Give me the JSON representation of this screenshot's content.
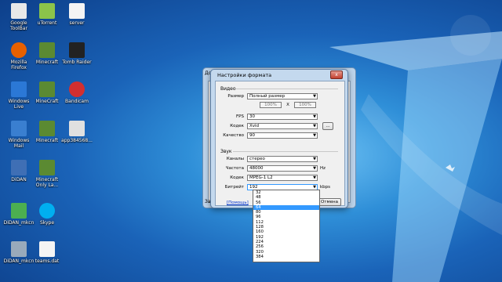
{
  "desktop": {
    "icons": [
      {
        "label": "Google ToolBar",
        "icon": "google-toolbar-icon"
      },
      {
        "label": "uTorrent",
        "icon": "utorrent-icon"
      },
      {
        "label": "server",
        "icon": "file-icon"
      },
      {
        "label": "Mozilla Firefox",
        "icon": "firefox-icon"
      },
      {
        "label": "Minecraft",
        "icon": "minecraft-icon"
      },
      {
        "label": "Tomb Raider",
        "icon": "tomb-raider-icon"
      },
      {
        "label": "Windows Live",
        "icon": "windows-live-icon"
      },
      {
        "label": "MineCraft",
        "icon": "minecraft-icon"
      },
      {
        "label": "Bandicam",
        "icon": "bandicam-icon"
      },
      {
        "label": "Windows Mail",
        "icon": "windows-mail-icon"
      },
      {
        "label": "Minecraft",
        "icon": "minecraft-icon"
      },
      {
        "label": "app384568...",
        "icon": "app-icon"
      },
      {
        "label": "DiDAN",
        "icon": "computer-icon"
      },
      {
        "label": "Minecraft Only La...",
        "icon": "minecraft-icon"
      },
      {
        "label": "DiDAN_mkcn",
        "icon": "folder-icon"
      },
      {
        "label": "Skype",
        "icon": "skype-icon"
      },
      {
        "label": "DiDAN_mkcn",
        "icon": "settings-icon"
      },
      {
        "label": "teams.dat",
        "icon": "file-icon"
      }
    ]
  },
  "background_window": {
    "title": "До",
    "left_label": "За"
  },
  "dialog": {
    "title": "Настройки формата",
    "close_label": "x",
    "video": {
      "group_label": "Видео",
      "size_label": "Размер",
      "size_value": "Полный размер",
      "width_pct": "100%",
      "times": "X",
      "height_pct": "100%",
      "fps_label": "FPS",
      "fps_value": "30",
      "codec_label": "Кодек",
      "codec_value": "Xvid",
      "codec_button": "...",
      "quality_label": "Качество",
      "quality_value": "90"
    },
    "audio": {
      "group_label": "Звук",
      "channels_label": "Каналы",
      "channels_value": "стерео",
      "freq_label": "Частота",
      "freq_value": "48000",
      "freq_unit": "Hz",
      "codec_label": "Кодек",
      "codec_value": "MPEG-1 L2",
      "bitrate_label": "Битрейт",
      "bitrate_value": "192",
      "bitrate_unit": "kbps"
    },
    "help_link": "[Помощь]",
    "cancel_button": "Отмена"
  },
  "bitrate_dropdown": {
    "options": [
      "32",
      "48",
      "56",
      "64",
      "80",
      "96",
      "112",
      "128",
      "160",
      "192",
      "224",
      "256",
      "320",
      "384"
    ],
    "selected": "64"
  },
  "colors": {
    "selection": "#3399ff",
    "titlebar": "#c4d9ee",
    "close": "#c2402f"
  }
}
